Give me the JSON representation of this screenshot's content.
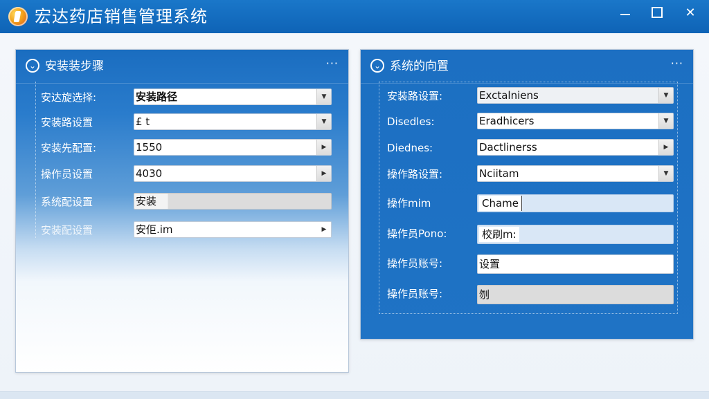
{
  "window": {
    "title": "宏达药店销售管理系统",
    "controls": {
      "minimize": "—",
      "maximize": "□",
      "close": "✕"
    }
  },
  "colors": {
    "titlebar": "#0e63b6",
    "panel_blue": "#1c6fc2",
    "field_gray": "#dcdcdc"
  },
  "left_panel": {
    "title": "安装装步骤",
    "menu": "···",
    "rows": [
      {
        "label": "安达旋选择:",
        "value": "安装路径",
        "has_dropdown": true,
        "style": "white",
        "bold": true
      },
      {
        "label": "安装路设置",
        "value": "£ t",
        "has_dropdown": true,
        "style": "white"
      },
      {
        "label": "安装先配置:",
        "value": "1550",
        "has_dropdown": true,
        "style": "white"
      },
      {
        "label": "操作员设置",
        "value": "4030",
        "has_dropdown": true,
        "style": "white"
      },
      {
        "label": "系统配设置",
        "value": "安装",
        "has_dropdown": false,
        "style": "gray"
      },
      {
        "label": "安装配设置",
        "value": "安佢.im",
        "has_dropdown": true,
        "style": "white"
      }
    ]
  },
  "right_panel": {
    "title": "系统的向置",
    "menu": "···",
    "rows": [
      {
        "label": "安装路设置:",
        "value": "Exctalniens",
        "has_dropdown": true,
        "style": "gray"
      },
      {
        "label": "Disedles:",
        "value": "Eradhicers",
        "has_dropdown": true,
        "style": "white"
      },
      {
        "label": "Diednes:",
        "value": "Dactlinerss",
        "has_dropdown": true,
        "style": "white"
      },
      {
        "label": "操作路设置:",
        "value": "Nciitam",
        "has_dropdown": true,
        "style": "white"
      },
      {
        "label": "操作mim",
        "value": "Chame",
        "has_dropdown": false,
        "style": "lightblue",
        "boxed": true
      },
      {
        "label": "操作员Pono:",
        "value": "校刷m:",
        "has_dropdown": false,
        "style": "lightblue",
        "boxed": true
      },
      {
        "label": "操作员账号:",
        "value": "设置",
        "has_dropdown": false,
        "style": "white"
      },
      {
        "label": "操作员账号:",
        "value": "刎",
        "has_dropdown": false,
        "style": "gray"
      }
    ]
  }
}
